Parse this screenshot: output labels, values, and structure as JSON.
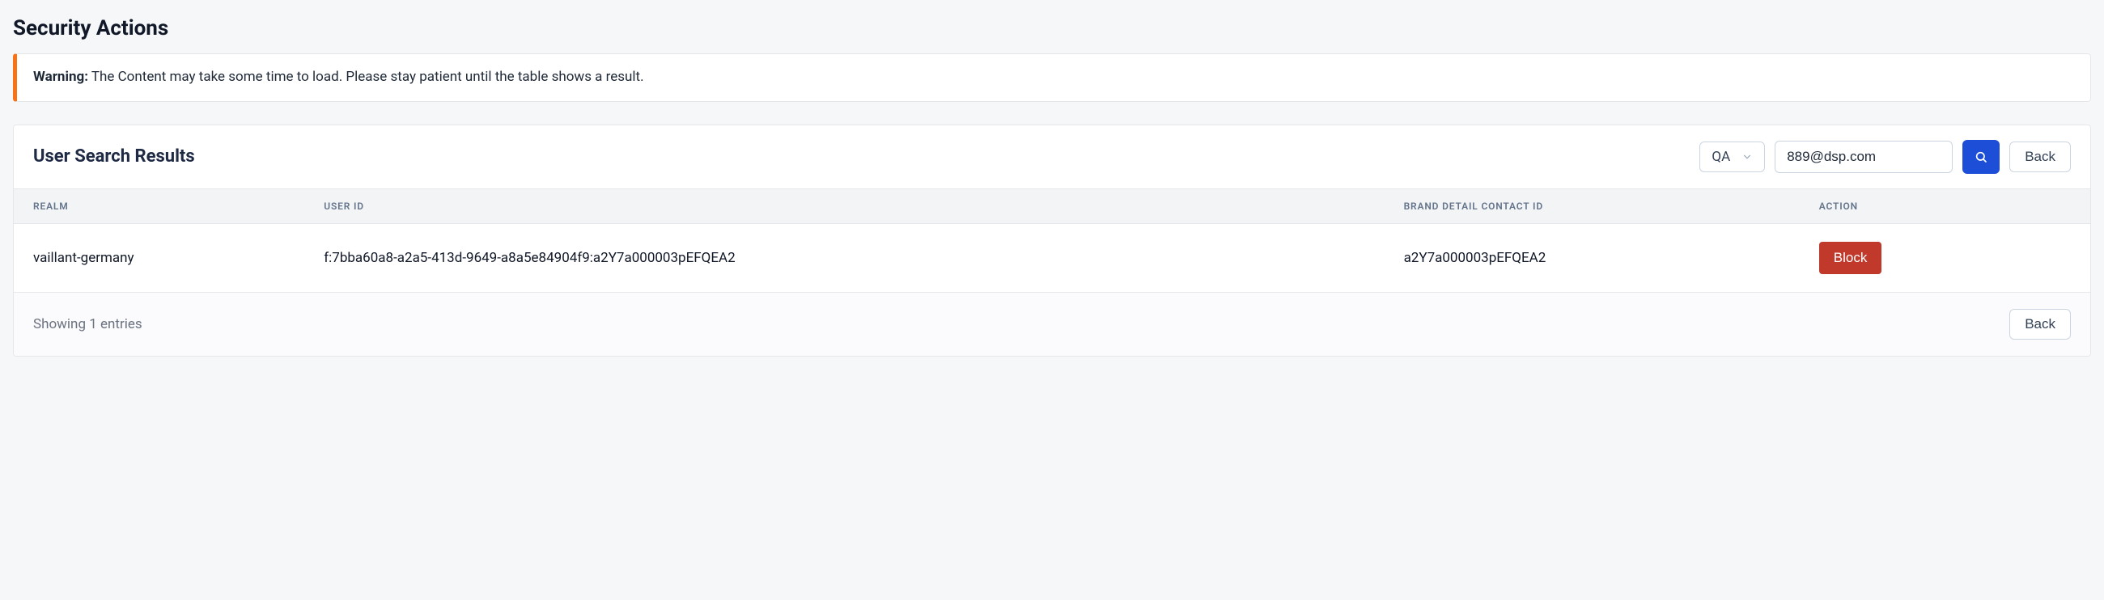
{
  "page": {
    "title": "Security Actions"
  },
  "warning": {
    "label": "Warning:",
    "text": " The Content may take some time to load. Please stay patient until the table shows a result."
  },
  "search": {
    "section_title": "User Search Results",
    "environment_selected": "QA",
    "query_value": "889@dsp.com",
    "back_label": "Back"
  },
  "table": {
    "headers": {
      "realm": "REALM",
      "user_id": "USER ID",
      "brand_detail_contact_id": "BRAND DETAIL CONTACT ID",
      "action": "ACTION"
    },
    "rows": [
      {
        "realm": "vaillant-germany",
        "user_id": "f:7bba60a8-a2a5-413d-9649-a8a5e84904f9:a2Y7a000003pEFQEA2",
        "brand_detail_contact_id": "a2Y7a000003pEFQEA2",
        "action_label": "Block"
      }
    ]
  },
  "footer": {
    "showing_text": "Showing 1 entries",
    "back_label": "Back"
  }
}
